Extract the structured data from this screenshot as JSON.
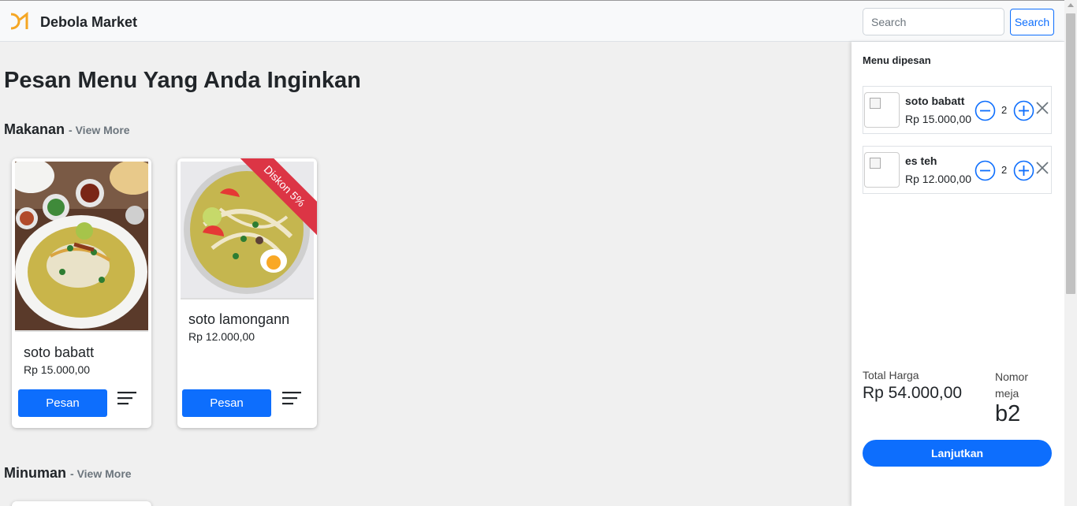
{
  "navbar": {
    "brand": "Debola Market",
    "search_placeholder": "Search",
    "search_button": "Search"
  },
  "main": {
    "title": "Pesan Menu Yang Anda Inginkan",
    "sections": [
      {
        "name": "Makanan",
        "view_more": "- View More",
        "items": [
          {
            "name": "soto babatt",
            "price": "Rp 15.000,00",
            "button": "Pesan"
          },
          {
            "name": "soto lamongann",
            "price": "Rp 12.000,00",
            "button": "Pesan",
            "badge": "Diskon 5%"
          }
        ]
      },
      {
        "name": "Minuman",
        "view_more": "- View More"
      }
    ]
  },
  "sidebar": {
    "title": "Menu dipesan",
    "orders": [
      {
        "name": "soto babatt",
        "price": "Rp 15.000,00",
        "qty": "2"
      },
      {
        "name": "es teh",
        "price": "Rp 12.000,00",
        "qty": "2"
      }
    ],
    "total_label": "Total Harga",
    "total_value": "Rp 54.000,00",
    "table_label": "Nomor meja",
    "table_value": "b2",
    "continue_button": "Lanjutkan"
  },
  "colors": {
    "primary": "#0d6efd",
    "badge": "#dc3545",
    "logo": "#f5a623"
  }
}
